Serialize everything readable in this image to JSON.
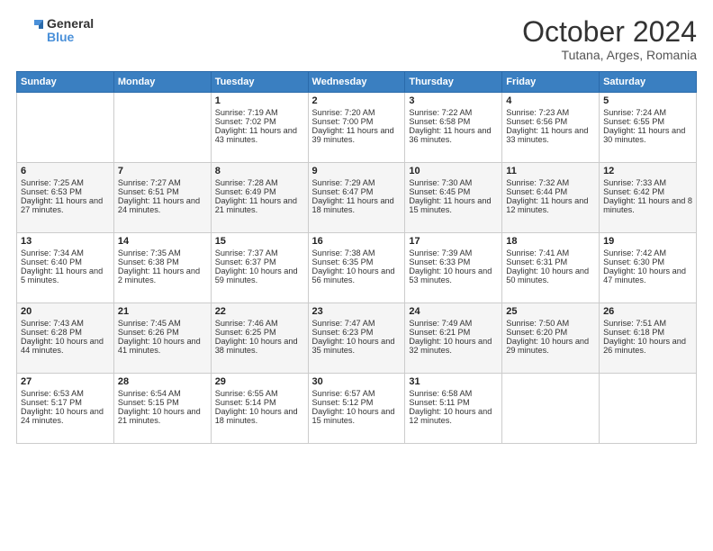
{
  "header": {
    "logo_line1": "General",
    "logo_line2": "Blue",
    "month": "October 2024",
    "location": "Tutana, Arges, Romania"
  },
  "days_of_week": [
    "Sunday",
    "Monday",
    "Tuesday",
    "Wednesday",
    "Thursday",
    "Friday",
    "Saturday"
  ],
  "weeks": [
    [
      {
        "day": "",
        "content": ""
      },
      {
        "day": "",
        "content": ""
      },
      {
        "day": "1",
        "content": "Sunrise: 7:19 AM\nSunset: 7:02 PM\nDaylight: 11 hours and 43 minutes."
      },
      {
        "day": "2",
        "content": "Sunrise: 7:20 AM\nSunset: 7:00 PM\nDaylight: 11 hours and 39 minutes."
      },
      {
        "day": "3",
        "content": "Sunrise: 7:22 AM\nSunset: 6:58 PM\nDaylight: 11 hours and 36 minutes."
      },
      {
        "day": "4",
        "content": "Sunrise: 7:23 AM\nSunset: 6:56 PM\nDaylight: 11 hours and 33 minutes."
      },
      {
        "day": "5",
        "content": "Sunrise: 7:24 AM\nSunset: 6:55 PM\nDaylight: 11 hours and 30 minutes."
      }
    ],
    [
      {
        "day": "6",
        "content": "Sunrise: 7:25 AM\nSunset: 6:53 PM\nDaylight: 11 hours and 27 minutes."
      },
      {
        "day": "7",
        "content": "Sunrise: 7:27 AM\nSunset: 6:51 PM\nDaylight: 11 hours and 24 minutes."
      },
      {
        "day": "8",
        "content": "Sunrise: 7:28 AM\nSunset: 6:49 PM\nDaylight: 11 hours and 21 minutes."
      },
      {
        "day": "9",
        "content": "Sunrise: 7:29 AM\nSunset: 6:47 PM\nDaylight: 11 hours and 18 minutes."
      },
      {
        "day": "10",
        "content": "Sunrise: 7:30 AM\nSunset: 6:45 PM\nDaylight: 11 hours and 15 minutes."
      },
      {
        "day": "11",
        "content": "Sunrise: 7:32 AM\nSunset: 6:44 PM\nDaylight: 11 hours and 12 minutes."
      },
      {
        "day": "12",
        "content": "Sunrise: 7:33 AM\nSunset: 6:42 PM\nDaylight: 11 hours and 8 minutes."
      }
    ],
    [
      {
        "day": "13",
        "content": "Sunrise: 7:34 AM\nSunset: 6:40 PM\nDaylight: 11 hours and 5 minutes."
      },
      {
        "day": "14",
        "content": "Sunrise: 7:35 AM\nSunset: 6:38 PM\nDaylight: 11 hours and 2 minutes."
      },
      {
        "day": "15",
        "content": "Sunrise: 7:37 AM\nSunset: 6:37 PM\nDaylight: 10 hours and 59 minutes."
      },
      {
        "day": "16",
        "content": "Sunrise: 7:38 AM\nSunset: 6:35 PM\nDaylight: 10 hours and 56 minutes."
      },
      {
        "day": "17",
        "content": "Sunrise: 7:39 AM\nSunset: 6:33 PM\nDaylight: 10 hours and 53 minutes."
      },
      {
        "day": "18",
        "content": "Sunrise: 7:41 AM\nSunset: 6:31 PM\nDaylight: 10 hours and 50 minutes."
      },
      {
        "day": "19",
        "content": "Sunrise: 7:42 AM\nSunset: 6:30 PM\nDaylight: 10 hours and 47 minutes."
      }
    ],
    [
      {
        "day": "20",
        "content": "Sunrise: 7:43 AM\nSunset: 6:28 PM\nDaylight: 10 hours and 44 minutes."
      },
      {
        "day": "21",
        "content": "Sunrise: 7:45 AM\nSunset: 6:26 PM\nDaylight: 10 hours and 41 minutes."
      },
      {
        "day": "22",
        "content": "Sunrise: 7:46 AM\nSunset: 6:25 PM\nDaylight: 10 hours and 38 minutes."
      },
      {
        "day": "23",
        "content": "Sunrise: 7:47 AM\nSunset: 6:23 PM\nDaylight: 10 hours and 35 minutes."
      },
      {
        "day": "24",
        "content": "Sunrise: 7:49 AM\nSunset: 6:21 PM\nDaylight: 10 hours and 32 minutes."
      },
      {
        "day": "25",
        "content": "Sunrise: 7:50 AM\nSunset: 6:20 PM\nDaylight: 10 hours and 29 minutes."
      },
      {
        "day": "26",
        "content": "Sunrise: 7:51 AM\nSunset: 6:18 PM\nDaylight: 10 hours and 26 minutes."
      }
    ],
    [
      {
        "day": "27",
        "content": "Sunrise: 6:53 AM\nSunset: 5:17 PM\nDaylight: 10 hours and 24 minutes."
      },
      {
        "day": "28",
        "content": "Sunrise: 6:54 AM\nSunset: 5:15 PM\nDaylight: 10 hours and 21 minutes."
      },
      {
        "day": "29",
        "content": "Sunrise: 6:55 AM\nSunset: 5:14 PM\nDaylight: 10 hours and 18 minutes."
      },
      {
        "day": "30",
        "content": "Sunrise: 6:57 AM\nSunset: 5:12 PM\nDaylight: 10 hours and 15 minutes."
      },
      {
        "day": "31",
        "content": "Sunrise: 6:58 AM\nSunset: 5:11 PM\nDaylight: 10 hours and 12 minutes."
      },
      {
        "day": "",
        "content": ""
      },
      {
        "day": "",
        "content": ""
      }
    ]
  ]
}
